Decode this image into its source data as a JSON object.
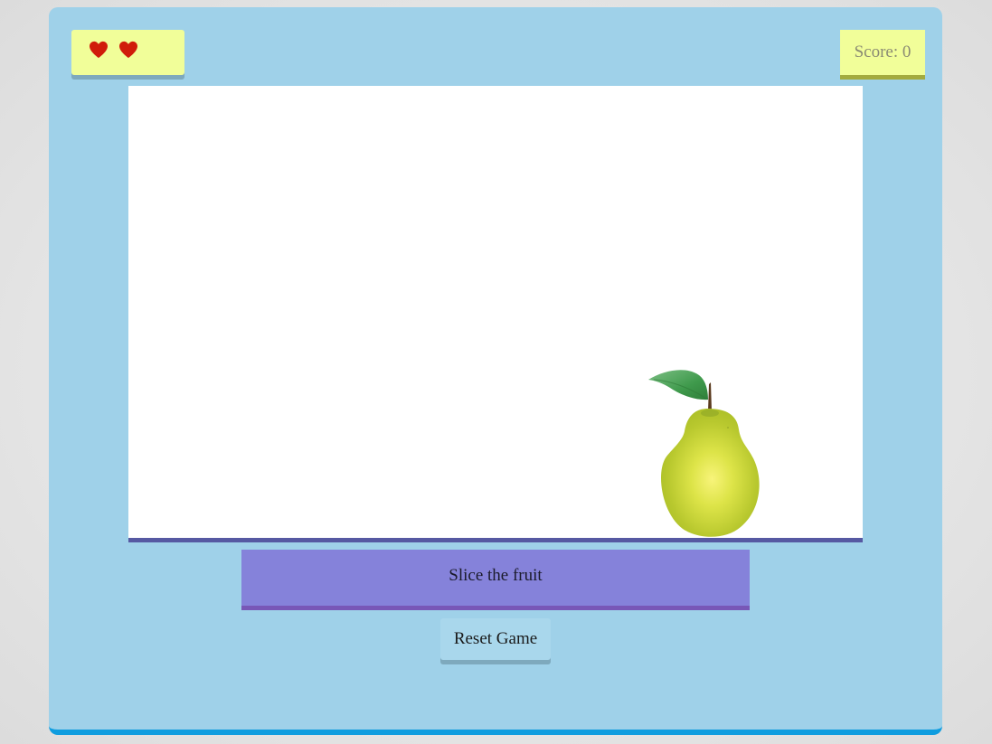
{
  "game": {
    "lives": {
      "count": 2,
      "icon": "heart-icon",
      "color": "#d01c0a"
    },
    "score_text": "Score: 0",
    "current_fruit": {
      "name": "pear",
      "icon": "pear-icon"
    },
    "instruction": "Slice the fruit",
    "reset_label": "Reset Game"
  },
  "colors": {
    "panel": "#9fd1e9",
    "panel_border": "#0f9ddf",
    "hud_background": "#f1fe99",
    "instruction_background": "#8582da",
    "game_area": "#ffffff",
    "game_area_border": "#5659a2"
  }
}
